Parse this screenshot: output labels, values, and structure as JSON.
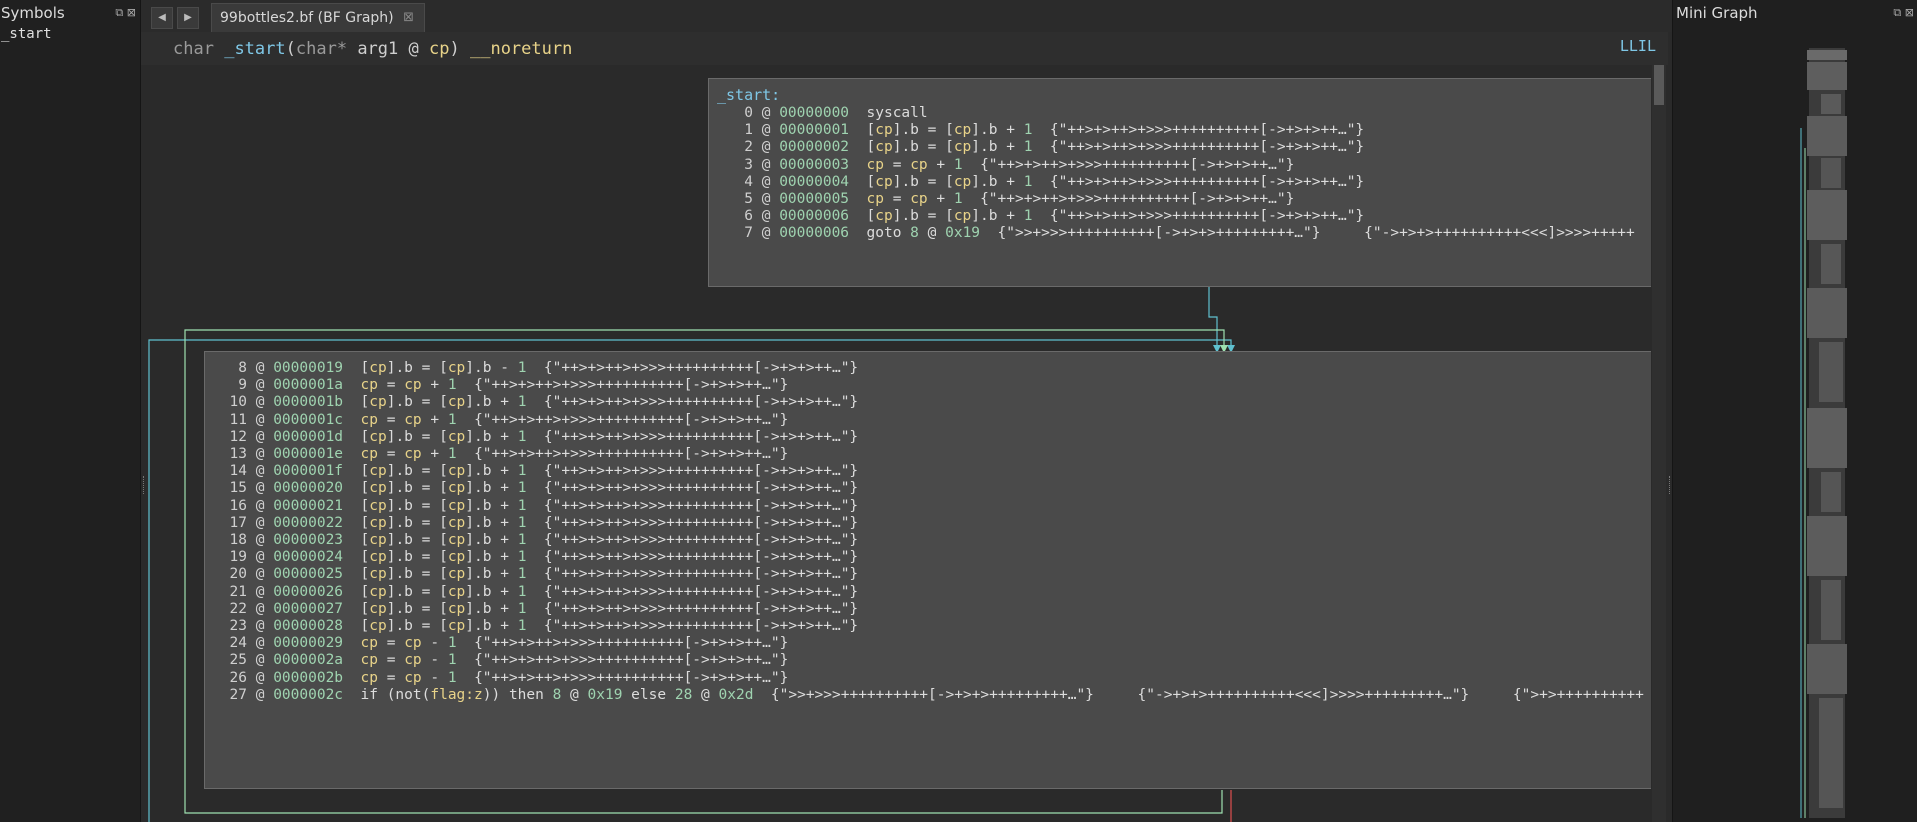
{
  "symbols_panel": {
    "title": "Symbols",
    "items": [
      "_start"
    ]
  },
  "tab": {
    "label": "99bottles2.bf (BF Graph)"
  },
  "signature": {
    "ret_type": "char",
    "name": "_start",
    "param_type": "char*",
    "param_name": "arg1",
    "at": "@",
    "reg": "cp",
    "attr": "__noreturn"
  },
  "view_mode": "LLIL",
  "minigraph_panel": {
    "title": "Mini Graph"
  },
  "colors": {
    "edge_cyan": "#5fc0cf",
    "edge_green": "#9ee0b0",
    "edge_red": "#e05050",
    "addr": "#9fd3b0",
    "register": "#e8d389",
    "label": "#7fc7e6"
  },
  "blocks": [
    {
      "label": "_start:",
      "lines": [
        {
          "i": "0",
          "addr": "00000000",
          "text": "syscall"
        },
        {
          "i": "1",
          "addr": "00000001",
          "text": "[cp].b = [cp].b + 1",
          "str": "{\"++>+>++>+>>>++++++++++[->+>+>++…\"}"
        },
        {
          "i": "2",
          "addr": "00000002",
          "text": "[cp].b = [cp].b + 1",
          "str": "{\"++>+>++>+>>>++++++++++[->+>+>++…\"}"
        },
        {
          "i": "3",
          "addr": "00000003",
          "text": "cp = cp + 1",
          "str": "{\"++>+>++>+>>>++++++++++[->+>+>++…\"}"
        },
        {
          "i": "4",
          "addr": "00000004",
          "text": "[cp].b = [cp].b + 1",
          "str": "{\"++>+>++>+>>>++++++++++[->+>+>++…\"}"
        },
        {
          "i": "5",
          "addr": "00000005",
          "text": "cp = cp + 1",
          "str": "{\"++>+>++>+>>>++++++++++[->+>+>++…\"}"
        },
        {
          "i": "6",
          "addr": "00000006",
          "text": "[cp].b = [cp].b + 1",
          "str": "{\"++>+>++>+>>>++++++++++[->+>+>++…\"}"
        },
        {
          "i": "7",
          "addr": "00000006",
          "text": "goto 8 @ 0x19",
          "str": "{\">>+>>>++++++++++[->+>+>+++++++++…\"}     {\"->+>+>++++++++++<<<]>>>>+++++"
        }
      ]
    },
    {
      "label": "",
      "lines": [
        {
          "i": "8",
          "addr": "00000019",
          "text": "[cp].b = [cp].b - 1",
          "str": "{\"++>+>++>+>>>++++++++++[->+>+>++…\"}"
        },
        {
          "i": "9",
          "addr": "0000001a",
          "text": "cp = cp + 1",
          "str": "{\"++>+>++>+>>>++++++++++[->+>+>++…\"}"
        },
        {
          "i": "10",
          "addr": "0000001b",
          "text": "[cp].b = [cp].b + 1",
          "str": "{\"++>+>++>+>>>++++++++++[->+>+>++…\"}"
        },
        {
          "i": "11",
          "addr": "0000001c",
          "text": "cp = cp + 1",
          "str": "{\"++>+>++>+>>>++++++++++[->+>+>++…\"}"
        },
        {
          "i": "12",
          "addr": "0000001d",
          "text": "[cp].b = [cp].b + 1",
          "str": "{\"++>+>++>+>>>++++++++++[->+>+>++…\"}"
        },
        {
          "i": "13",
          "addr": "0000001e",
          "text": "cp = cp + 1",
          "str": "{\"++>+>++>+>>>++++++++++[->+>+>++…\"}"
        },
        {
          "i": "14",
          "addr": "0000001f",
          "text": "[cp].b = [cp].b + 1",
          "str": "{\"++>+>++>+>>>++++++++++[->+>+>++…\"}"
        },
        {
          "i": "15",
          "addr": "00000020",
          "text": "[cp].b = [cp].b + 1",
          "str": "{\"++>+>++>+>>>++++++++++[->+>+>++…\"}"
        },
        {
          "i": "16",
          "addr": "00000021",
          "text": "[cp].b = [cp].b + 1",
          "str": "{\"++>+>++>+>>>++++++++++[->+>+>++…\"}"
        },
        {
          "i": "17",
          "addr": "00000022",
          "text": "[cp].b = [cp].b + 1",
          "str": "{\"++>+>++>+>>>++++++++++[->+>+>++…\"}"
        },
        {
          "i": "18",
          "addr": "00000023",
          "text": "[cp].b = [cp].b + 1",
          "str": "{\"++>+>++>+>>>++++++++++[->+>+>++…\"}"
        },
        {
          "i": "19",
          "addr": "00000024",
          "text": "[cp].b = [cp].b + 1",
          "str": "{\"++>+>++>+>>>++++++++++[->+>+>++…\"}"
        },
        {
          "i": "20",
          "addr": "00000025",
          "text": "[cp].b = [cp].b + 1",
          "str": "{\"++>+>++>+>>>++++++++++[->+>+>++…\"}"
        },
        {
          "i": "21",
          "addr": "00000026",
          "text": "[cp].b = [cp].b + 1",
          "str": "{\"++>+>++>+>>>++++++++++[->+>+>++…\"}"
        },
        {
          "i": "22",
          "addr": "00000027",
          "text": "[cp].b = [cp].b + 1",
          "str": "{\"++>+>++>+>>>++++++++++[->+>+>++…\"}"
        },
        {
          "i": "23",
          "addr": "00000028",
          "text": "[cp].b = [cp].b + 1",
          "str": "{\"++>+>++>+>>>++++++++++[->+>+>++…\"}"
        },
        {
          "i": "24",
          "addr": "00000029",
          "text": "cp = cp - 1",
          "str": "{\"++>+>++>+>>>++++++++++[->+>+>++…\"}"
        },
        {
          "i": "25",
          "addr": "0000002a",
          "text": "cp = cp - 1",
          "str": "{\"++>+>++>+>>>++++++++++[->+>+>++…\"}"
        },
        {
          "i": "26",
          "addr": "0000002b",
          "text": "cp = cp - 1",
          "str": "{\"++>+>++>+>>>++++++++++[->+>+>++…\"}"
        },
        {
          "i": "27",
          "addr": "0000002c",
          "text": "if (not(flag:z)) then 8 @ 0x19 else 28 @ 0x2d",
          "str": "{\">>+>>>++++++++++[->+>+>+++++++++…\"}     {\"->+>+>++++++++++<<<]>>>>+++++++++…\"}     {\">+>++++++++++"
        }
      ]
    }
  ]
}
